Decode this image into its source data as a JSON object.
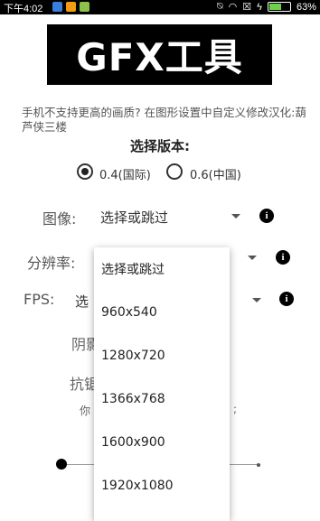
{
  "status_bar": {
    "time": "下午4:02",
    "battery": "63%",
    "battery_level": 0.63
  },
  "app": {
    "logo_text": "GFX工具",
    "note": "手机不支持更高的画质? 在图形设置中自定义修改汉化:葫芦侠三楼",
    "version_title": "选择版本:",
    "versions": [
      {
        "label": "0.4(国际)",
        "selected": true
      },
      {
        "label": "0.6(中国)",
        "selected": false
      }
    ],
    "settings": [
      {
        "label": "图像:",
        "value": "选择或跳过"
      },
      {
        "label": "分辨率:",
        "value": ""
      },
      {
        "label": "FPS:",
        "value": "选"
      }
    ],
    "hidden_rows": {
      "shadow_label": "阴影",
      "aa_label": "抗锯",
      "hint_start": "你",
      "hint_end": ";"
    }
  },
  "dropdown": {
    "items": [
      "选择或跳过",
      "960x540",
      "1280x720",
      "1366x768",
      "1600x900",
      "1920x1080"
    ]
  },
  "colors": {
    "accent": "#000000",
    "battery": "#6cd24a"
  }
}
